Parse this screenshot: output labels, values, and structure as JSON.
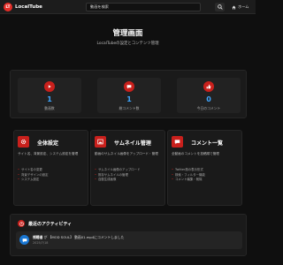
{
  "header": {
    "logo_text": "LT",
    "brand": "LocalTube",
    "search_value": "動画を検索",
    "home_label": "ホーム"
  },
  "hero": {
    "title": "管理画面",
    "subtitle": "LocalTubeの設定とコンテンツ管理"
  },
  "stats": [
    {
      "icon": "play-icon",
      "value": "1",
      "label": "動画数"
    },
    {
      "icon": "comment-icon",
      "value": "1",
      "label": "総コメント数"
    },
    {
      "icon": "thumbs-up-icon",
      "value": "0",
      "label": "今日のコメント"
    }
  ],
  "cards": [
    {
      "icon": "gear-icon",
      "title": "全体設定",
      "desc": "サイト名、背景設定、システム設定を管理",
      "items": [
        "サイト名の変更",
        "背景デザインの設定",
        "システム設定"
      ]
    },
    {
      "icon": "image-icon",
      "title": "サムネイル管理",
      "desc": "動画のサムネイル画像をアップロード・管理",
      "items": [
        "サムネイル画像のアップロード",
        "既存サムネイルの管理",
        "自動生成画像"
      ]
    },
    {
      "icon": "comment-icon",
      "title": "コメント一覧",
      "desc": "全動画のコメントを投稿順で管理",
      "items": [
        "Twitter風の表示形式",
        "検索・フィルター機能",
        "コメント編集・削除"
      ]
    }
  ],
  "activity": {
    "title": "最近のアクティビティ",
    "items": [
      {
        "user": "視聴者",
        "text": "が 【MOD SOUL】 動画01.mp4にコメントしました",
        "time": "2025/7/18"
      }
    ]
  },
  "colors": {
    "accent": "#c9201c",
    "stat_value": "#3ea6ff",
    "background": "#0f0f0f"
  }
}
